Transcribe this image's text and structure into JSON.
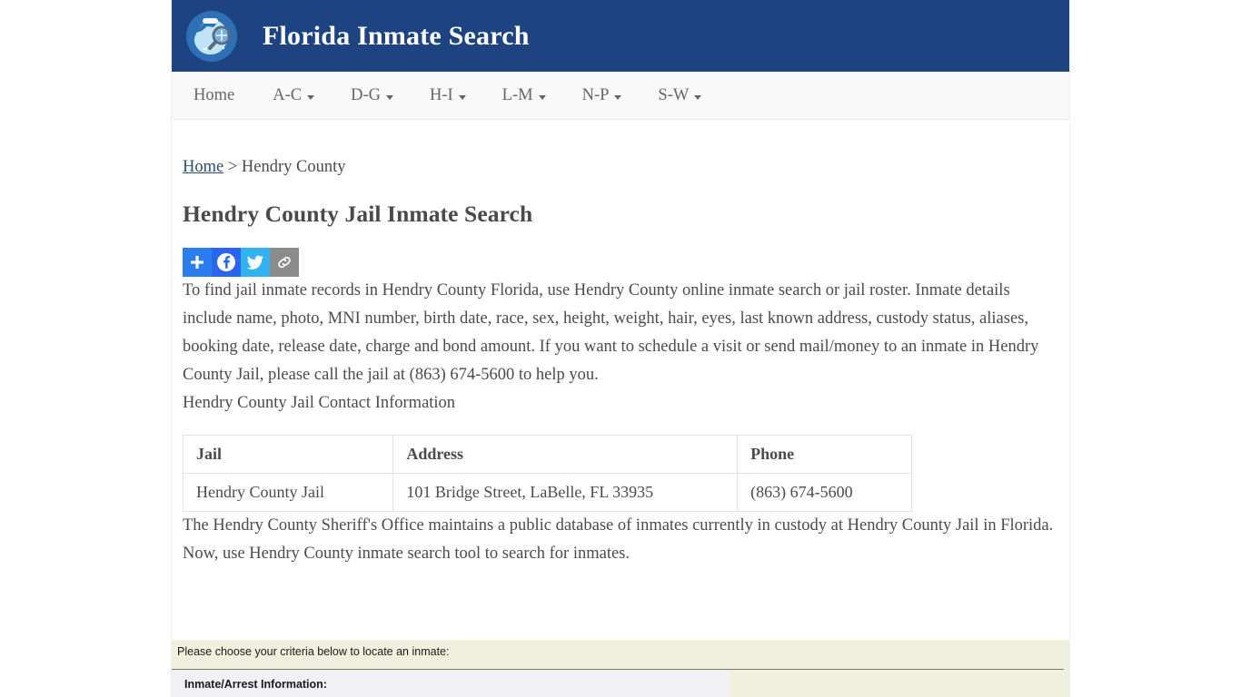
{
  "header": {
    "site_title": "Florida Inmate Search",
    "logo_icon": "state-map-magnifier-icon",
    "bg_color": "#1d4480"
  },
  "nav": {
    "items": [
      {
        "label": "Home",
        "has_caret": false
      },
      {
        "label": "A-C",
        "has_caret": true
      },
      {
        "label": "D-G",
        "has_caret": true
      },
      {
        "label": "H-I",
        "has_caret": true
      },
      {
        "label": "L-M",
        "has_caret": true
      },
      {
        "label": "N-P",
        "has_caret": true
      },
      {
        "label": "S-W",
        "has_caret": true
      }
    ]
  },
  "breadcrumb": {
    "home_label": "Home",
    "separator": " > ",
    "current": "Hendry County"
  },
  "page": {
    "title": "Hendry County Jail Inmate Search"
  },
  "share": {
    "buttons": [
      {
        "name": "addthis-share-button",
        "icon": "plus-icon",
        "color": "#2a7def"
      },
      {
        "name": "facebook-share-button",
        "icon": "facebook-icon",
        "color": "#2a65f0"
      },
      {
        "name": "twitter-share-button",
        "icon": "twitter-bird-icon",
        "color": "#32b2f2"
      },
      {
        "name": "copy-link-button",
        "icon": "chain-link-icon",
        "color": "#8b8b8b"
      }
    ]
  },
  "body": {
    "intro": "To find jail inmate records in Hendry County Florida, use Hendry County online inmate search or jail roster. Inmate details include name, photo, MNI number, birth date, race, sex, height, weight, hair, eyes, last known address, custody status, aliases, booking date, release date, charge and bond amount. If you want to schedule a visit or send mail/money to an inmate in Hendry County Jail, please call the jail at (863) 674-5600 to help you.",
    "contact_heading": "Hendry County Jail Contact Information",
    "after_table": "The Hendry County Sheriff's Office maintains a public database of inmates currently in custody at Hendry County Jail in Florida. Now, use Hendry County inmate search tool to search for inmates."
  },
  "contact_table": {
    "headers": [
      "Jail",
      "Address",
      "Phone"
    ],
    "rows": [
      [
        "Hendry County Jail",
        "101 Bridge Street, LaBelle, FL 33935",
        "(863) 674-5600"
      ]
    ]
  },
  "search_widget": {
    "instruction": "Please choose your criteria below to locate an inmate:",
    "panel_label": "Inmate/Arrest Information:",
    "bg_color": "#eff0dd",
    "panel_color": "#f1f1f4"
  }
}
